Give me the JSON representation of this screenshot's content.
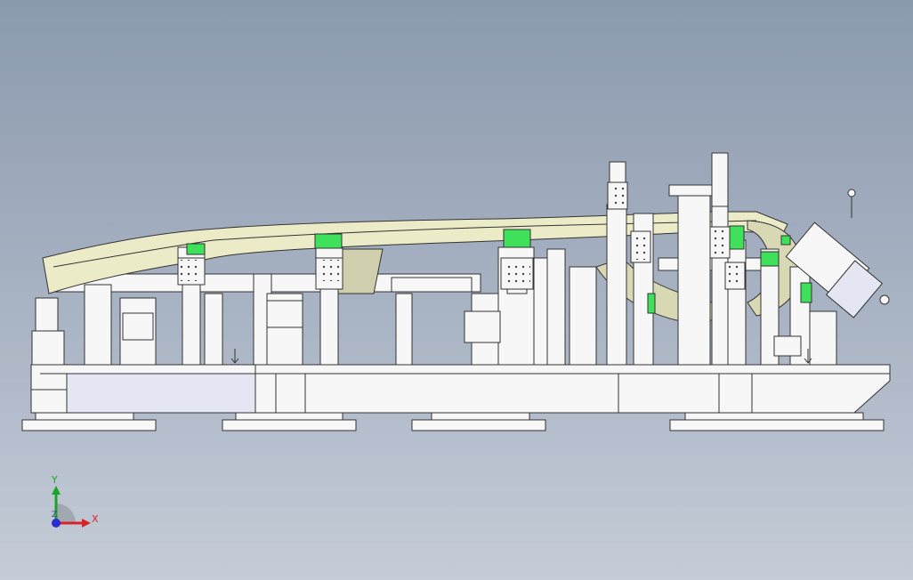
{
  "viewport": {
    "background_top": "#8c9aae",
    "background_bottom": "#c5ccd7",
    "part_color": "#ecebc8",
    "clamp_color": "#3fe05a",
    "steel_color": "#f7f7f7",
    "outline_color": "#333333",
    "base_shade_color": "#e4e6f4"
  },
  "triad": {
    "x_label": "X",
    "y_label": "Y",
    "z_label": "Z",
    "x_color": "#d8232a",
    "y_color": "#1aa52a",
    "z_color": "#2b2bd0"
  }
}
